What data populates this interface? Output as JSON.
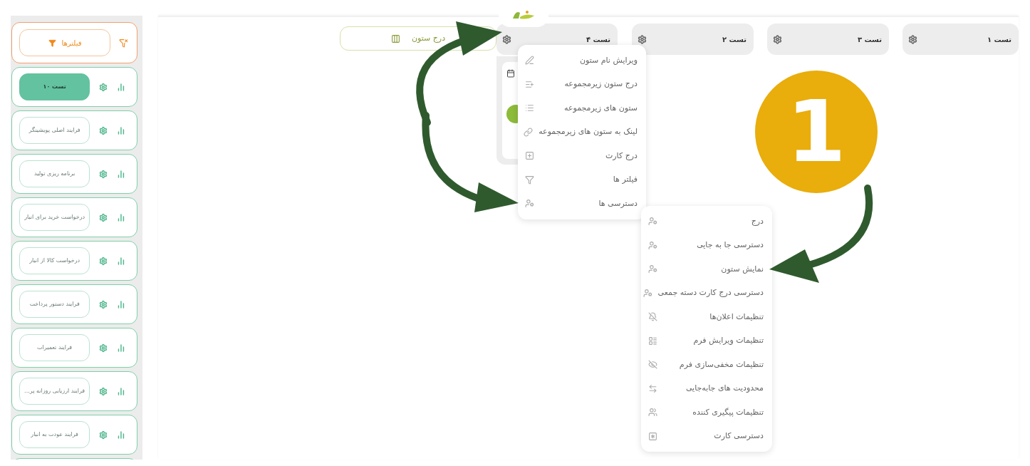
{
  "sidebar": {
    "filter_button": {
      "label": "فیلترها"
    },
    "items": [
      {
        "label": "تست ۱۰",
        "selected": true
      },
      {
        "label": "فرایند اصلی پویشینگر",
        "selected": false
      },
      {
        "label": "برنامه ریزی تولید",
        "selected": false
      },
      {
        "label": "درخواست خرید برای انبار",
        "selected": false
      },
      {
        "label": "درخواست کالا از انبار",
        "selected": false
      },
      {
        "label": "فرایند دستور پرداخت",
        "selected": false
      },
      {
        "label": "فرایند تعمیرات",
        "selected": false
      },
      {
        "label": "فرایند ارزیابی روزانه پر...",
        "selected": false
      },
      {
        "label": "فرایند عودت به انبار",
        "selected": false
      }
    ]
  },
  "board": {
    "insert_column_button": "درج ستون",
    "columns": [
      {
        "title": "تست ۱"
      },
      {
        "title": "تست ۳"
      },
      {
        "title": "تست ۲"
      },
      {
        "title": "تست ۴"
      }
    ]
  },
  "column_menu": [
    "ویرایش نام ستون",
    "درج ستون زیرمجموعه",
    "ستون های زیرمجموعه",
    "لینک به ستون های زیرمجموعه",
    "درج کارت",
    "فیلتر ها",
    "دسترسی ها"
  ],
  "access_menu": [
    "درج",
    "دسترسی جا به جایی",
    "نمایش ستون",
    "دسترسی درج کارت دسته جمعی",
    "تنظیمات اعلان‌ها",
    "تنظیمات ویرایش فرم",
    "تنظیمات مخفی‌سازی فرم",
    "محدودیت های جابه‌جایی",
    "تنظیمات پیگیری کننده",
    "دسترسی کارت"
  ],
  "step_badge": "1"
}
